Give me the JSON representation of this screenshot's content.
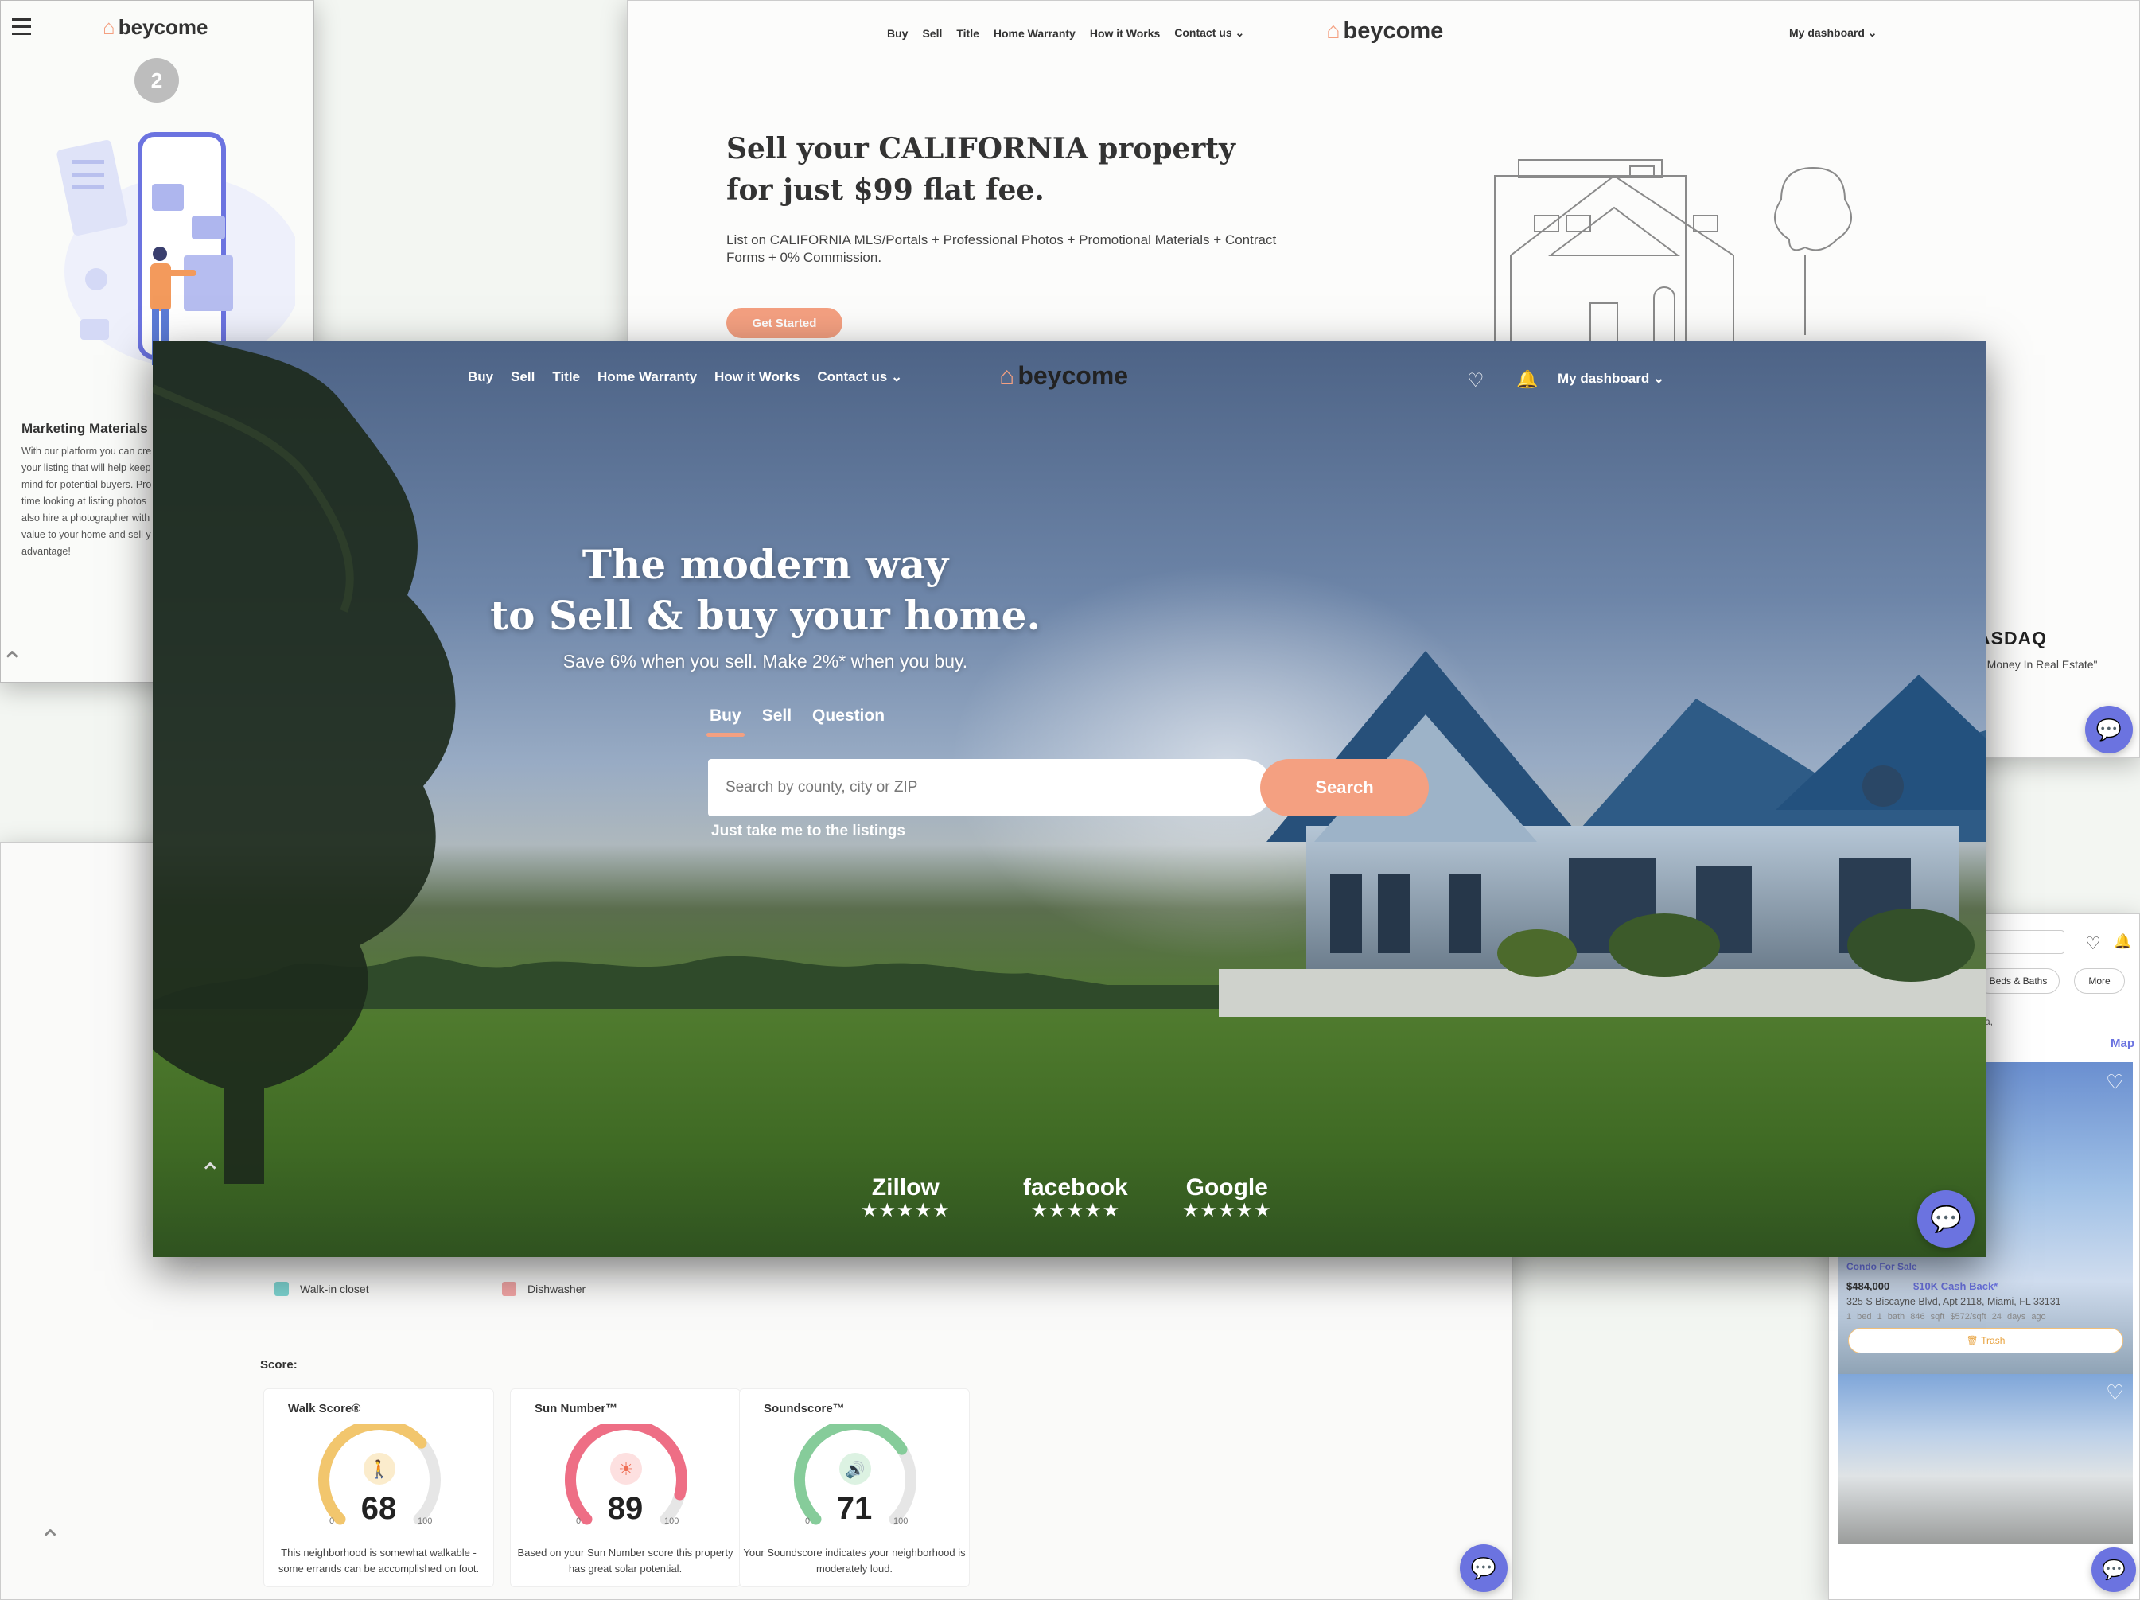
{
  "colors": {
    "accent": "#f4a081",
    "chat": "#6b73e0",
    "walk": "#f2c66d",
    "sun": "#ee6e85",
    "sound": "#86cc9a"
  },
  "mobile": {
    "logo": "beycome",
    "step_number": "2",
    "section_title": "Marketing Materials",
    "section_body": "With our platform you can cre your listing that will help keep mind for potential buyers. Pro time looking at listing photos also hire a photographer with value to your home and sell y advantage!"
  },
  "sellpage": {
    "nav": [
      "Buy",
      "Sell",
      "Title",
      "Home Warranty",
      "How it Works",
      "Contact us"
    ],
    "logo": "beycome",
    "dashboard": "My dashboard",
    "headline": "Sell your CALIFORNIA property for just $99 flat fee.",
    "subtext": "List on CALIFORNIA MLS/Portals + Professional Photos + Promotional Materials + Contract Forms + 0% Commission.",
    "cta": "Get Started",
    "press_logo": "ASDAQ",
    "press_quote": "Of Money In Real Estate\""
  },
  "details": {
    "features": [
      "Walk-in closet",
      "Dishwasher"
    ],
    "score_label": "Score:",
    "scores": [
      {
        "title": "Walk Score®",
        "value": 68,
        "min": "0",
        "max": "100",
        "desc": "This neighborhood is somewhat walkable - some errands can be accomplished on foot."
      },
      {
        "title": "Sun Number™",
        "value": 89,
        "min": "0",
        "max": "100",
        "desc": "Based on your Sun Number score this property has great solar potential."
      },
      {
        "title": "Soundscore™",
        "value": 71,
        "min": "0",
        "max": "100",
        "desc": "Your Soundscore indicates your neighborhood is moderately loud."
      }
    ]
  },
  "results": {
    "filter_beds": "Beds & Baths",
    "filter_more": "More",
    "fragment": "a,",
    "map_link": "Map",
    "listing": {
      "tag": "Condo For Sale",
      "price": "$484,000",
      "cashback": "$10K Cash Back*",
      "address": "325 S Biscayne Blvd, Apt 2118, Miami, FL 33131",
      "meta": "1 bed  1 bath  846 sqft  $572/sqft  24 days ago",
      "trash": "Trash"
    }
  },
  "hero": {
    "nav": [
      "Buy",
      "Sell",
      "Title",
      "Home Warranty",
      "How it Works",
      "Contact us"
    ],
    "logo": "beycome",
    "dashboard": "My dashboard",
    "headline_line1": "The modern way",
    "headline_line2": "to Sell & buy your home.",
    "subheadline": "Save 6% when you sell. Make 2%* when you buy.",
    "tabs": [
      "Buy",
      "Sell",
      "Question"
    ],
    "search_placeholder": "Search by county, city or ZIP",
    "search_button": "Search",
    "listings_link": "Just take me to the listings",
    "reviews": [
      {
        "brand": "Zillow",
        "stars": "★★★★★",
        "rating": 5
      },
      {
        "brand": "facebook",
        "stars": "★★★★★",
        "rating": 4.5
      },
      {
        "brand": "Google",
        "stars": "★★★★★",
        "rating": 5
      }
    ]
  }
}
